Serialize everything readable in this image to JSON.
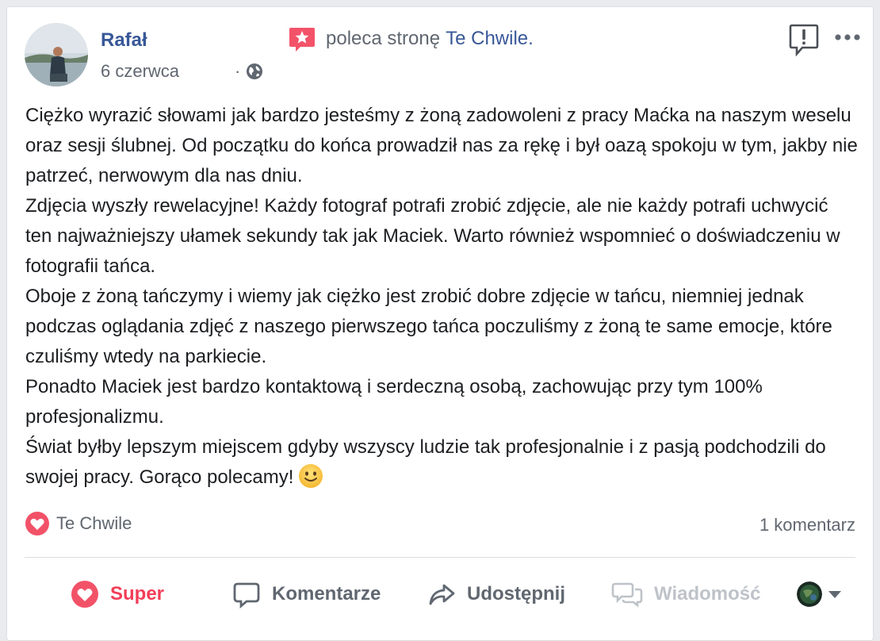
{
  "post": {
    "author": "Rafał",
    "date": "6 czerwca",
    "date_separator": "·",
    "recommend_text": "poleca stronę",
    "page_name": "Te Chwile."
  },
  "body": {
    "paragraphs": [
      "Ciężko wyrazić słowami jak bardzo jesteśmy z żoną zadowoleni z pracy Maćka na naszym weselu oraz sesji ślubnej. Od początku do końca prowadził nas za rękę i był oazą spokoju w tym, jakby nie patrzeć, nerwowym dla nas dniu.",
      "Zdjęcia wyszły rewelacyjne! Każdy fotograf potrafi zrobić zdjęcie, ale nie każdy potrafi uchwycić ten najważniejszy ułamek sekundy tak jak Maciek. Warto również wspomnieć o doświadczeniu w fotografii tańca.",
      "Oboje z żoną tańczymy i wiemy jak ciężko jest zrobić dobre zdjęcie w tańcu, niemniej jednak podczas oglądania zdjęć z naszego pierwszego tańca poczuliśmy z żoną te same emocje, które czuliśmy wtedy na parkiecie.",
      "Ponadto Maciek jest bardzo kontaktową i serdeczną osobą, zachowując przy tym 100% profesjonalizmu.",
      "Świat byłby lepszym miejscem gdyby wszyscy ludzie tak profesjonalnie i z pasją podchodzili do swojej pracy. Gorąco polecamy!"
    ]
  },
  "reactions": {
    "reactor": "Te Chwile",
    "comments": "1 komentarz"
  },
  "actions": {
    "super": "Super",
    "comment": "Komentarze",
    "share": "Udostępnij",
    "message": "Wiadomość"
  },
  "icons": {
    "recommend": "recommend-star-badge-icon",
    "globe": "globe-icon",
    "report": "report-icon",
    "more": "more-options-icon",
    "heart": "heart-reaction-icon",
    "smile": "smile-emoji-icon"
  },
  "colors": {
    "link": "#385898",
    "secondary": "#606770",
    "super": "#f33e58",
    "disabled": "#bec3c9"
  }
}
